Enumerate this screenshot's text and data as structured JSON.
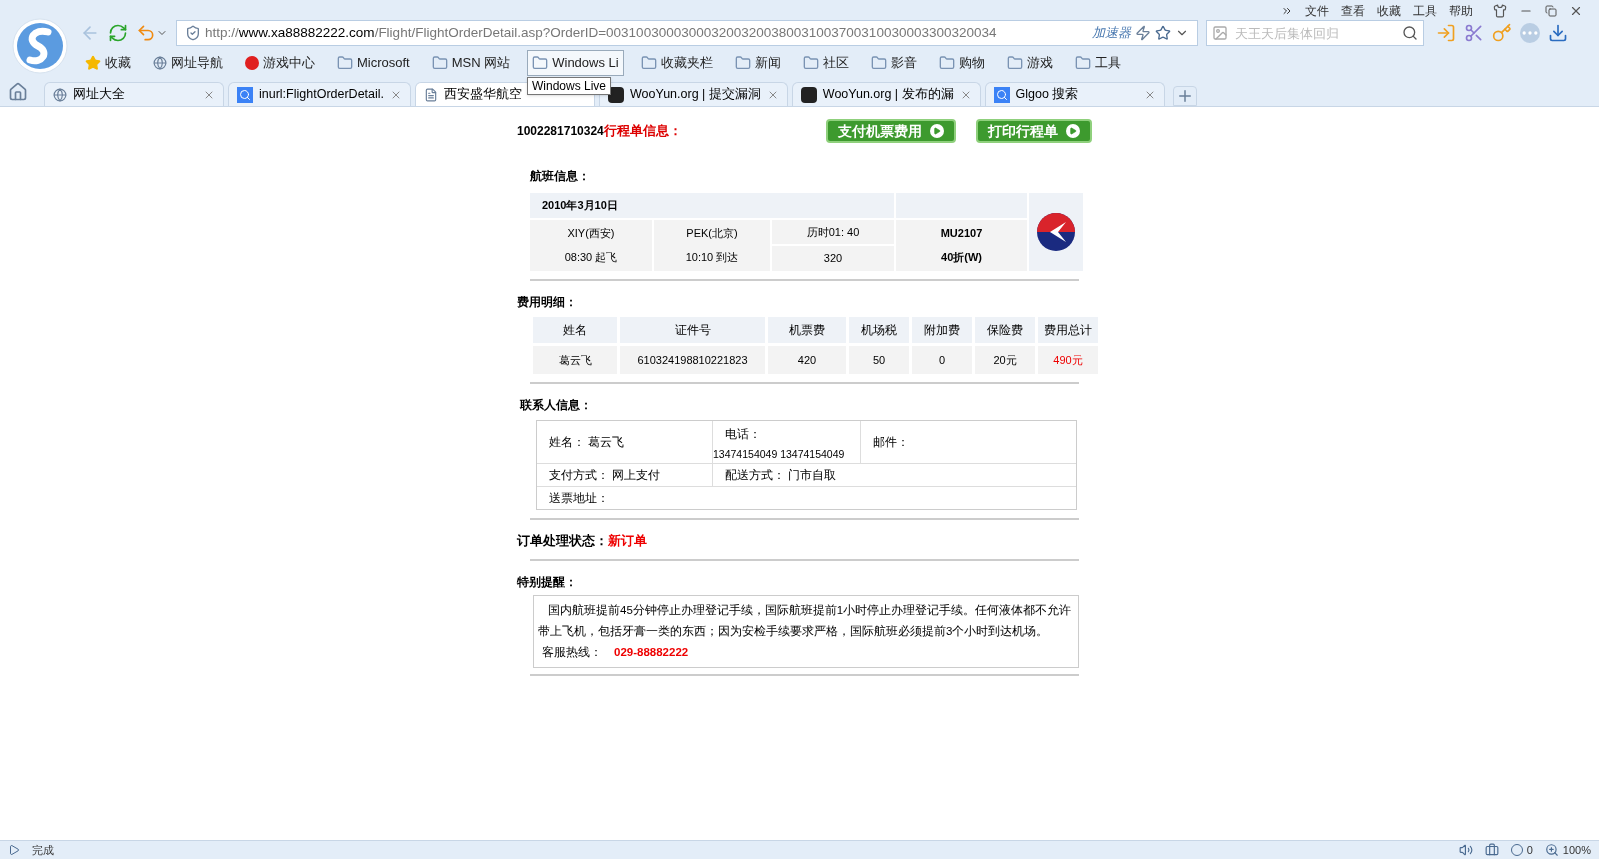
{
  "menu": [
    "文件",
    "查看",
    "收藏",
    "工具",
    "帮助"
  ],
  "address_bar": {
    "scheme": "http://",
    "host": "www.xa88882222.com",
    "path": "/Flight/FlightOrderDetail.asp?OrderID=0031003000300032003200380031003700310030003300320034",
    "accelerator": "加速器"
  },
  "search": {
    "placeholder": "天王天后集体回归"
  },
  "bookmarks": [
    {
      "kind": "star",
      "label": "收藏",
      "hovered": false
    },
    {
      "kind": "globe",
      "label": "网址导航",
      "hovered": false
    },
    {
      "kind": "game",
      "label": "游戏中心",
      "hovered": false
    },
    {
      "kind": "folder",
      "label": "Microsoft",
      "hovered": false
    },
    {
      "kind": "folder",
      "label": "MSN 网站",
      "hovered": false
    },
    {
      "kind": "folder",
      "label": "Windows Li",
      "hovered": true
    },
    {
      "kind": "folder",
      "label": "收藏夹栏",
      "hovered": false
    },
    {
      "kind": "folder",
      "label": "新闻",
      "hovered": false
    },
    {
      "kind": "folder",
      "label": "社区",
      "hovered": false
    },
    {
      "kind": "folder",
      "label": "影音",
      "hovered": false
    },
    {
      "kind": "folder",
      "label": "购物",
      "hovered": false
    },
    {
      "kind": "folder",
      "label": "游戏",
      "hovered": false
    },
    {
      "kind": "folder",
      "label": "工具",
      "hovered": false
    }
  ],
  "tooltip": "Windows Live",
  "tabs": [
    {
      "kind": "globe",
      "label": "网址大全",
      "selected": false
    },
    {
      "kind": "search",
      "label": "inurl:FlightOrderDetail.",
      "selected": false
    },
    {
      "kind": "page",
      "label": "西安盛华航空",
      "selected": true
    },
    {
      "kind": "site",
      "label": "WooYun.org | 提交漏洞",
      "selected": false
    },
    {
      "kind": "site",
      "label": "WooYun.org | 发布的漏",
      "selected": false
    },
    {
      "kind": "search",
      "label": "Glgoo 搜索",
      "selected": false
    }
  ],
  "page": {
    "order_no": "1002281710324",
    "order_title": "行程单信息：",
    "buttons": [
      "支付机票费用",
      "打印行程单"
    ],
    "flight": {
      "heading": "航班信息：",
      "date": "2010年3月10日",
      "from": "XIY(西安)",
      "depart": "08:30 起飞",
      "to": "PEK(北京)",
      "arrive": "10:10 到达",
      "duration": "历时01: 40",
      "aircraft": "320",
      "flight_no": "MU2107",
      "fare": "40折(W)"
    },
    "fees": {
      "heading": "费用明细：",
      "columns": [
        "姓名",
        "证件号",
        "机票费",
        "机场税",
        "附加费",
        "保险费",
        "费用总计"
      ],
      "row": [
        "葛云飞",
        "610324198810221823",
        "420",
        "50",
        "0",
        "20元",
        "490元"
      ]
    },
    "contact": {
      "heading": "联系人信息：",
      "name_label": "姓名：",
      "name": "葛云飞",
      "phone_label": "电话：",
      "phone": "13474154049 13474154049",
      "email_label": "邮件：",
      "pay_label": "支付方式：",
      "pay": "网上支付",
      "delivery_label": "配送方式：",
      "delivery": "门市自取",
      "address_label": "送票地址："
    },
    "status": {
      "label": "订单处理状态：",
      "value": "新订单"
    },
    "notice": {
      "heading": "特别提醒：",
      "text": "国内航班提前45分钟停止办理登记手续，国际航班提前1小时停止办理登记手续。任何液体都不允许带上飞机，包括牙膏一类的东西；因为安检手续要求严格，国际航班必须提前3个小时到达机场。",
      "hotline_label": "客服热线：",
      "hotline": "029-88882222"
    }
  },
  "status_bar": {
    "text": "完成",
    "count": "0",
    "zoom": "100%"
  }
}
